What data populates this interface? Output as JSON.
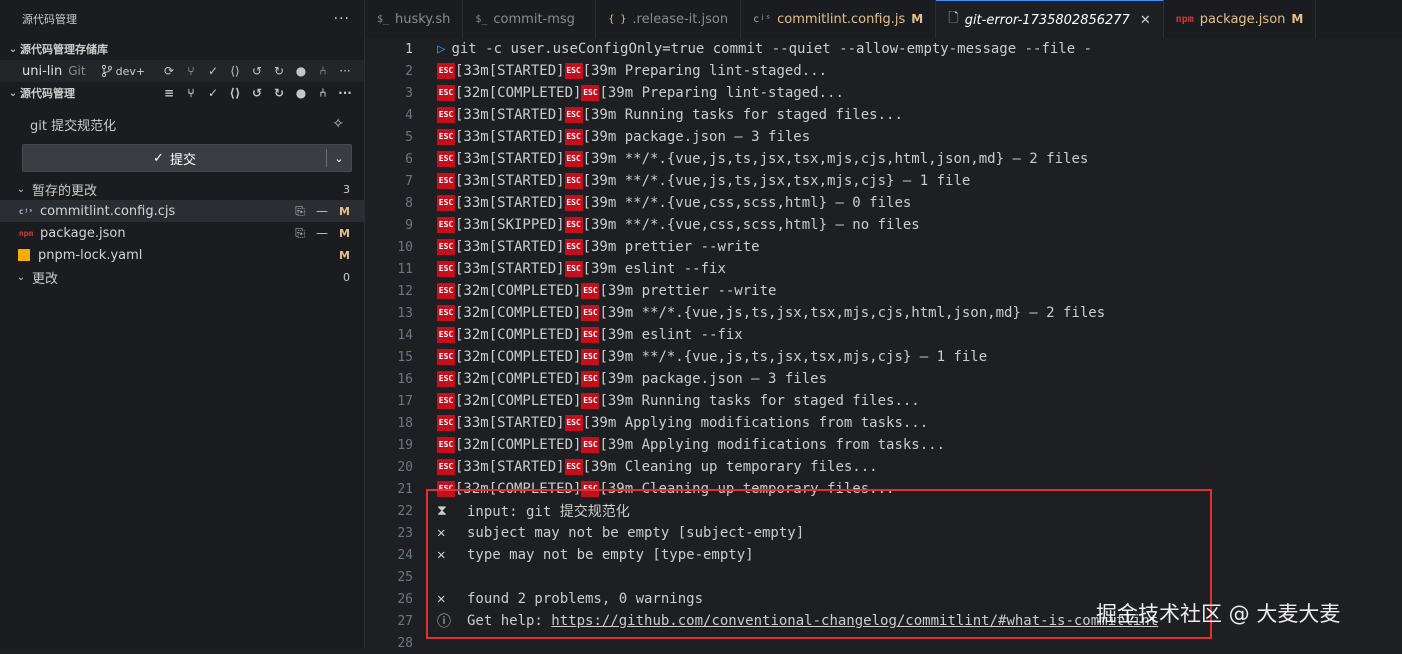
{
  "sidebar": {
    "header": "源代码管理",
    "more": "···",
    "repos_section": "源代码管理存储库",
    "repo": {
      "name": "uni-lin",
      "type": "Git",
      "branch": "dev+"
    },
    "scm_section": "源代码管理",
    "commit_message": "git 提交规范化",
    "commit_button": "提交",
    "staged": {
      "label": "暂存的更改",
      "count": "3"
    },
    "files": [
      {
        "name": "commitlint.config.cjs",
        "status": "M",
        "icon": "cjs"
      },
      {
        "name": "package.json",
        "status": "M",
        "icon": "pkg"
      },
      {
        "name": "pnpm-lock.yaml",
        "status": "M",
        "icon": "yaml"
      }
    ],
    "changes": {
      "label": "更改",
      "count": "0"
    }
  },
  "tabs": [
    {
      "label": "husky.sh",
      "icon": "$_"
    },
    {
      "label": "commit-msg",
      "icon": "$_"
    },
    {
      "label": ".release-it.json",
      "icon": "{ }"
    },
    {
      "label": "commitlint.config.js",
      "status": "M",
      "icon": "cjs"
    },
    {
      "label": "git-error-1735802856277",
      "icon": "doc",
      "active": true
    },
    {
      "label": "package.json",
      "status": "M",
      "icon": "pkg"
    }
  ],
  "editor": {
    "line1": "git -c user.useConfigOnly=true commit --quiet --allow-empty-message --file -",
    "esc_label": "ESC",
    "lines": [
      [
        "[33m[STARTED]",
        "[39m Preparing lint-staged..."
      ],
      [
        "[32m[COMPLETED]",
        "[39m Preparing lint-staged..."
      ],
      [
        "[33m[STARTED]",
        "[39m Running tasks for staged files..."
      ],
      [
        "[33m[STARTED]",
        "[39m package.json — 3 files"
      ],
      [
        "[33m[STARTED]",
        "[39m **/*.{vue,js,ts,jsx,tsx,mjs,cjs,html,json,md} — 2 files"
      ],
      [
        "[33m[STARTED]",
        "[39m **/*.{vue,js,ts,jsx,tsx,mjs,cjs} — 1 file"
      ],
      [
        "[33m[STARTED]",
        "[39m **/*.{vue,css,scss,html} — 0 files"
      ],
      [
        "[33m[SKIPPED]",
        "[39m **/*.{vue,css,scss,html} — no files"
      ],
      [
        "[33m[STARTED]",
        "[39m prettier --write"
      ],
      [
        "[33m[STARTED]",
        "[39m eslint --fix"
      ],
      [
        "[32m[COMPLETED]",
        "[39m prettier --write"
      ],
      [
        "[32m[COMPLETED]",
        "[39m **/*.{vue,js,ts,jsx,tsx,mjs,cjs,html,json,md} — 2 files"
      ],
      [
        "[32m[COMPLETED]",
        "[39m eslint --fix"
      ],
      [
        "[32m[COMPLETED]",
        "[39m **/*.{vue,js,ts,jsx,tsx,mjs,cjs} — 1 file"
      ],
      [
        "[32m[COMPLETED]",
        "[39m package.json — 3 files"
      ],
      [
        "[32m[COMPLETED]",
        "[39m Running tasks for staged files..."
      ],
      [
        "[33m[STARTED]",
        "[39m Applying modifications from tasks..."
      ],
      [
        "[32m[COMPLETED]",
        "[39m Applying modifications from tasks..."
      ],
      [
        "[33m[STARTED]",
        "[39m Cleaning up temporary files..."
      ],
      [
        "[32m[COMPLETED]",
        "[39m Cleaning up temporary files..."
      ]
    ],
    "errors": {
      "l22": {
        "sym": "⧗",
        "text": "input: git 提交规范化"
      },
      "l23": {
        "sym": "✕",
        "text": "subject may not be empty [subject-empty]"
      },
      "l24": {
        "sym": "✕",
        "text": "type may not be empty [type-empty]"
      },
      "l26": {
        "sym": "✕",
        "text": "found 2 problems, 0 warnings"
      },
      "l27": {
        "sym": "ⓘ",
        "text": "Get help: ",
        "link": "https://github.com/conventional-changelog/commitlint/#what-is-commitlint"
      }
    }
  },
  "watermark": "掘金技术社区 @ 大麦大麦",
  "colors": {
    "accent": "#3794ff",
    "esc_bg": "#c50f1f",
    "modified": "#e2c08d",
    "highlight": "#e03131"
  }
}
